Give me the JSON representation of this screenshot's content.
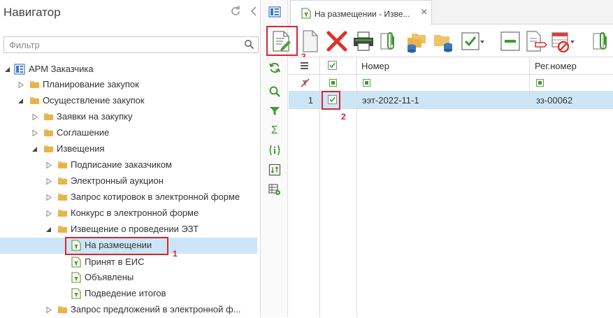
{
  "navigator": {
    "title": "Навигатор",
    "filter_placeholder": "Фильтр",
    "tree": [
      {
        "label": "АРМ Заказчика",
        "level": 0,
        "expanded": true,
        "kind": "root"
      },
      {
        "label": "Планирование закупок",
        "level": 1,
        "expanded": false,
        "kind": "folder"
      },
      {
        "label": "Осуществление закупок",
        "level": 1,
        "expanded": true,
        "kind": "folder"
      },
      {
        "label": "Заявки на закупку",
        "level": 2,
        "expanded": false,
        "kind": "folder"
      },
      {
        "label": "Соглашение",
        "level": 2,
        "expanded": false,
        "kind": "folder"
      },
      {
        "label": "Извещения",
        "level": 2,
        "expanded": true,
        "kind": "folder"
      },
      {
        "label": "Подписание заказчиком",
        "level": 3,
        "expanded": false,
        "kind": "folder"
      },
      {
        "label": "Электронный аукцион",
        "level": 3,
        "expanded": false,
        "kind": "folder"
      },
      {
        "label": "Запрос котировок в электронной форме",
        "level": 3,
        "expanded": false,
        "kind": "folder"
      },
      {
        "label": "Конкурс в электронной форме",
        "level": 3,
        "expanded": false,
        "kind": "folder"
      },
      {
        "label": "Извещение о проведении ЭЗТ",
        "level": 3,
        "expanded": true,
        "kind": "folder"
      },
      {
        "label": "На размещении",
        "level": 4,
        "kind": "doc",
        "selected": true
      },
      {
        "label": "Принят в ЕИС",
        "level": 4,
        "kind": "doc"
      },
      {
        "label": "Объявлены",
        "level": 4,
        "kind": "doc"
      },
      {
        "label": "Подведение итогов",
        "level": 4,
        "kind": "doc"
      },
      {
        "label": "Запрос предложений в электронной ф...",
        "level": 3,
        "expanded": false,
        "kind": "folder"
      }
    ]
  },
  "tab": {
    "label": "На размещении - Изве...",
    "close": "×"
  },
  "grid": {
    "columns": [
      "Номер",
      "Рег.номер"
    ],
    "rows": [
      {
        "index": "1",
        "checked": true,
        "number": "ээт-2022-11-1",
        "reg_number": "зз-00062"
      }
    ]
  },
  "callouts": {
    "one": "1",
    "two": "2",
    "three": "3"
  },
  "colors": {
    "accent": "#d9262c",
    "selection": "#cde6f7",
    "green": "#3f9a2f"
  }
}
